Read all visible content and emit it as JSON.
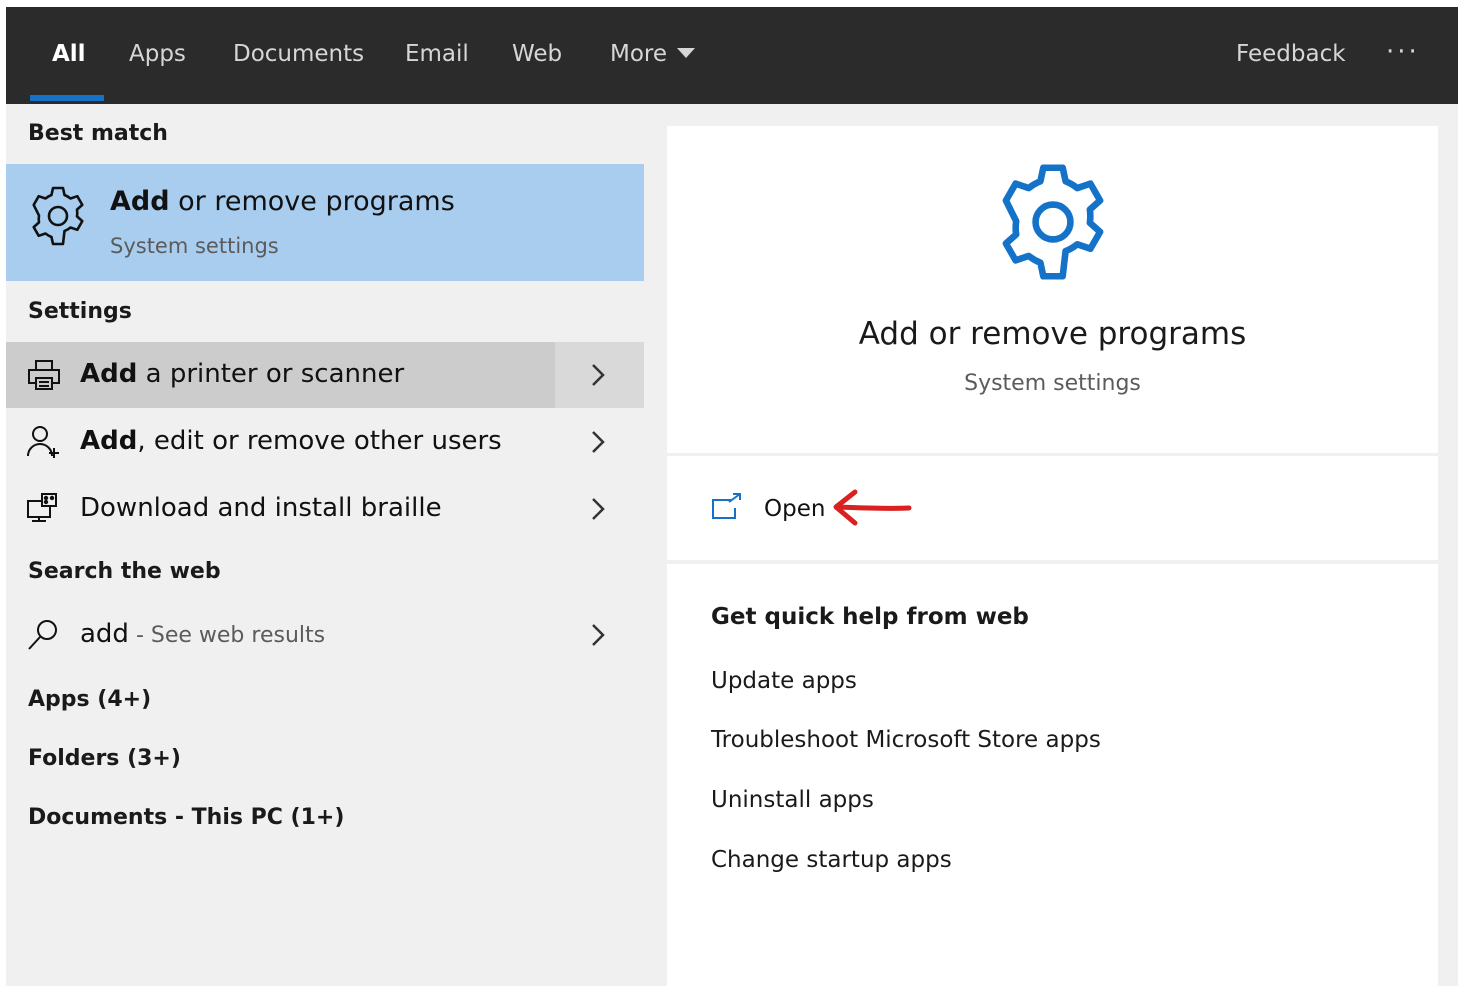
{
  "tabs": [
    {
      "label": "All"
    },
    {
      "label": "Apps"
    },
    {
      "label": "Documents"
    },
    {
      "label": "Email"
    },
    {
      "label": "Web"
    },
    {
      "label": "More"
    }
  ],
  "feedback_label": "Feedback",
  "more_options_label": "···",
  "colors": {
    "accent": "#1473c9",
    "best_match_bg": "#a9cdee",
    "selected_row_bg": "#cccccc",
    "annotation_arrow": "#d92121"
  },
  "left": {
    "best_match_header": "Best match",
    "best_match": {
      "title_bold": "Add",
      "title_rest": " or remove programs",
      "subtitle": "System settings",
      "icon": "gear-icon"
    },
    "settings_header": "Settings",
    "settings_items": [
      {
        "bold": "Add",
        "rest": " a printer or scanner",
        "icon": "printer-icon"
      },
      {
        "bold": "Add",
        "rest": ", edit or remove other users",
        "icon": "user-add-icon"
      },
      {
        "bold": "",
        "rest": "Download and install braille",
        "icon": "braille-device-icon"
      }
    ],
    "web_header": "Search the web",
    "web_item": {
      "query": "add",
      "hint": " - See web results",
      "icon": "search-icon"
    },
    "apps_header": "Apps (4+)",
    "folders_header": "Folders (3+)",
    "documents_header": "Documents - This PC (1+)"
  },
  "right": {
    "title": "Add or remove programs",
    "subtitle": "System settings",
    "open_label": "Open",
    "help_header": "Get quick help from web",
    "help_links": [
      "Update apps",
      "Troubleshoot Microsoft Store apps",
      "Uninstall apps",
      "Change startup apps"
    ]
  }
}
